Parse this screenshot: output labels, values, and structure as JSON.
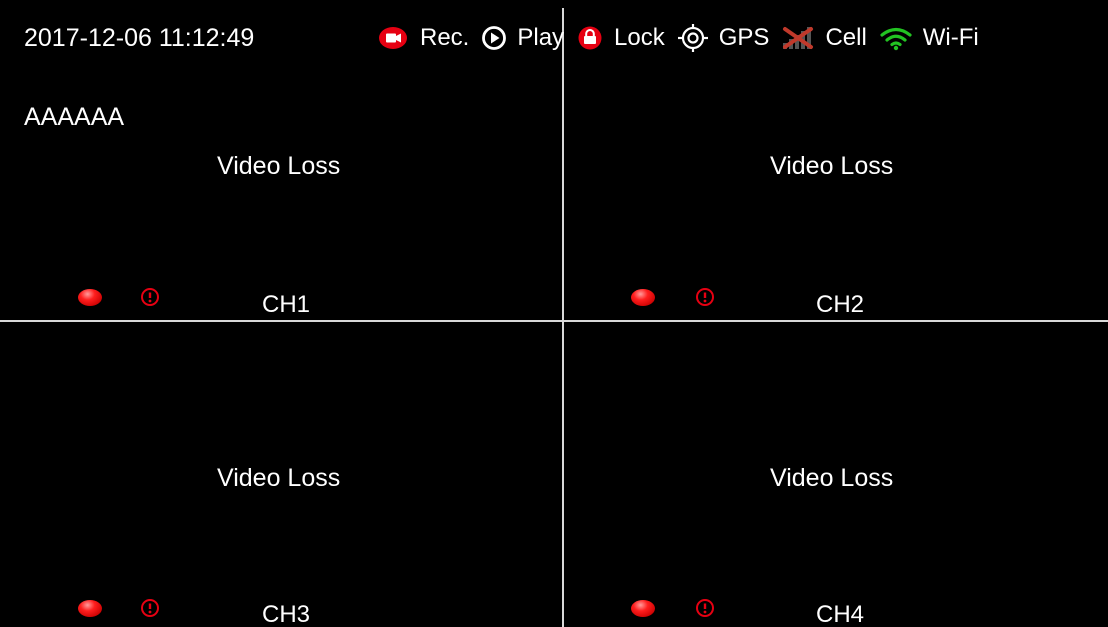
{
  "header": {
    "timestamp": "2017-12-06 11:12:49",
    "vehicle_id": "AAAAAA"
  },
  "status_bar": {
    "items": [
      {
        "label": "Rec.",
        "icon": "record-icon",
        "color": "#e60012"
      },
      {
        "label": "Play",
        "icon": "play-icon",
        "color": "#ffffff"
      },
      {
        "label": "Lock",
        "icon": "lock-icon",
        "color": "#e60012"
      },
      {
        "label": "GPS",
        "icon": "gps-icon",
        "color": "#ffffff"
      },
      {
        "label": "Cell",
        "icon": "cell-signal-icon",
        "color": "#c0392b"
      },
      {
        "label": "Wi-Fi",
        "icon": "wifi-icon",
        "color": "#22c322"
      }
    ]
  },
  "channels": [
    {
      "label": "CH1",
      "status": "Video Loss"
    },
    {
      "label": "CH2",
      "status": "Video Loss"
    },
    {
      "label": "CH3",
      "status": "Video Loss"
    },
    {
      "label": "CH4",
      "status": "Video Loss"
    }
  ],
  "colors": {
    "background": "#000000",
    "text": "#ffffff",
    "divider": "#d9d9d9",
    "alert_red": "#e60012",
    "wifi_green": "#22c322"
  }
}
